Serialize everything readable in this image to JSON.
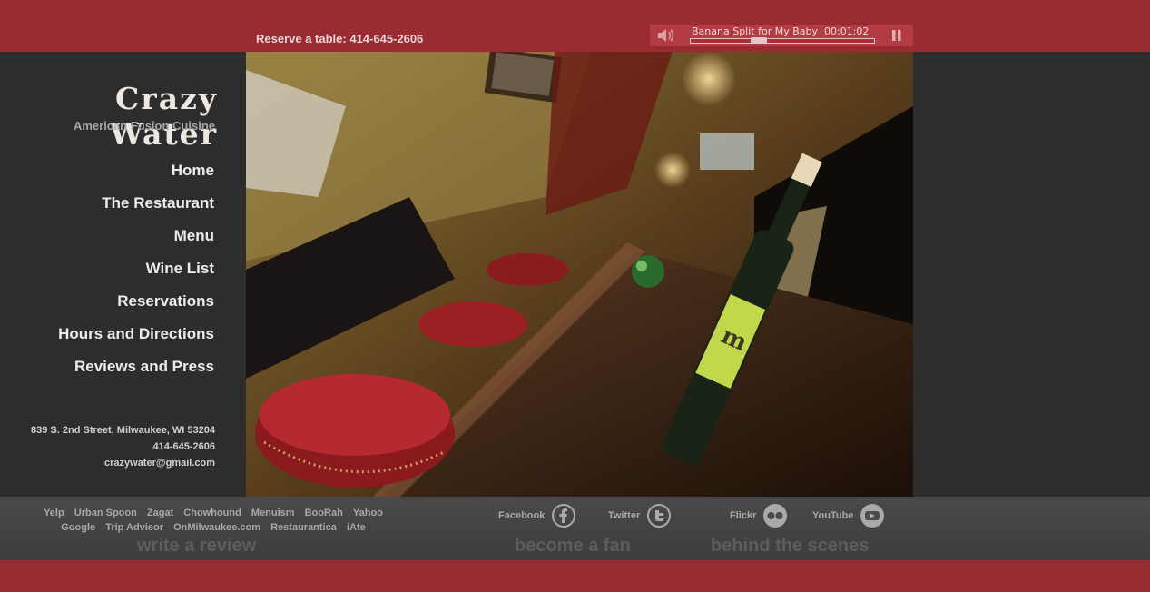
{
  "header": {
    "reserve_text": "Reserve a table: 414-645-2606"
  },
  "player": {
    "song": "Banana Split for My Baby",
    "time": "00:01:02",
    "progress": 0.37
  },
  "brand": {
    "name": "Crazy Water",
    "tagline": "American Fusion Cuisine"
  },
  "nav": {
    "items": [
      {
        "label": "Home"
      },
      {
        "label": "The Restaurant"
      },
      {
        "label": "Menu"
      },
      {
        "label": "Wine List"
      },
      {
        "label": "Reservations"
      },
      {
        "label": "Hours and Directions"
      },
      {
        "label": "Reviews and Press"
      }
    ]
  },
  "contact": {
    "address": "839 S. 2nd Street, Milwaukee, WI 53204",
    "phone": "414-645-2606",
    "email": "crazywater@gmail.com"
  },
  "review_links": {
    "row1": [
      "Yelp",
      "Urban Spoon",
      "Zagat",
      "Chowhound",
      "Menuism",
      "BooRah",
      "Yahoo"
    ],
    "row2": [
      "Google",
      "Trip Advisor",
      "OnMilwaukee.com",
      "Restaurantica",
      "iAte"
    ],
    "heading": "write a review"
  },
  "social": {
    "fan_heading": "become a fan",
    "scenes_heading": "behind the scenes",
    "facebook": "Facebook",
    "twitter": "Twitter",
    "flickr": "Flickr",
    "youtube": "YouTube"
  },
  "colors": {
    "brand_red": "#9b2b33",
    "dark_bg": "#2e2d2e"
  }
}
